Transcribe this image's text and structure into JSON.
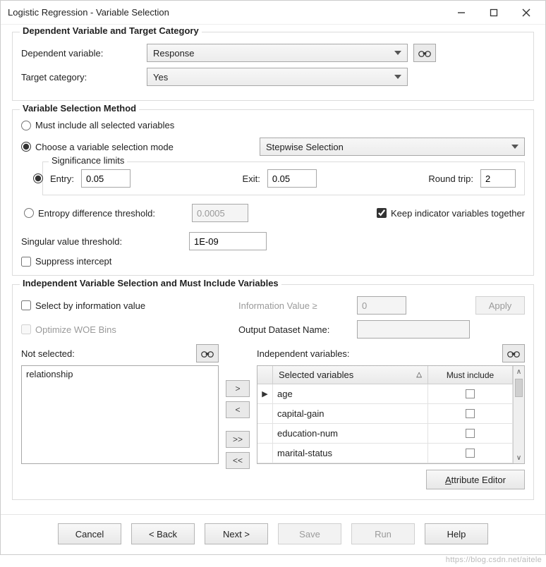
{
  "window": {
    "title": "Logistic Regression - Variable Selection"
  },
  "group1": {
    "title": "Dependent Variable and Target Category",
    "dep_label": "Dependent variable:",
    "dep_value": "Response",
    "target_label": "Target category:",
    "target_value": "Yes"
  },
  "group2": {
    "title": "Variable Selection Method",
    "opt_all": "Must include all selected variables",
    "opt_choose": "Choose a variable selection mode",
    "mode_value": "Stepwise Selection",
    "sig_title": "Significance limits",
    "entry_label": "Entry:",
    "entry_value": "0.05",
    "exit_label": "Exit:",
    "exit_value": "0.05",
    "round_label": "Round trip:",
    "round_value": "2",
    "entropy_label": "Entropy difference threshold:",
    "entropy_value": "0.0005",
    "keep_label": "Keep indicator variables together",
    "svt_label": "Singular value threshold:",
    "svt_value": "1E-09",
    "suppress_label": "Suppress intercept"
  },
  "group3": {
    "title": "Independent Variable Selection and Must Include Variables",
    "sel_iv_label": "Select by information value",
    "iv_ge_label": "Information Value ≥",
    "iv_ge_value": "0",
    "apply_label": "Apply",
    "opt_woe_label": "Optimize WOE Bins",
    "out_name_label": "Output Dataset Name:",
    "not_sel_label": "Not selected:",
    "not_sel_items": [
      "relationship"
    ],
    "ind_label": "Independent variables:",
    "col_sel": "Selected variables",
    "col_must": "Must include",
    "rows": [
      {
        "name": "age",
        "must": false,
        "current": true
      },
      {
        "name": "capital-gain",
        "must": false,
        "current": false
      },
      {
        "name": "education-num",
        "must": false,
        "current": false
      },
      {
        "name": "marital-status",
        "must": false,
        "current": false
      }
    ],
    "attr_editor": "Attribute Editor"
  },
  "buttons": {
    "cancel": "Cancel",
    "back": "< Back",
    "next": "Next >",
    "save": "Save",
    "run": "Run",
    "help": "Help"
  },
  "move": {
    "right": ">",
    "left": "<",
    "allright": ">>",
    "allleft": "<<"
  },
  "watermark": "https://blog.csdn.net/aitele"
}
